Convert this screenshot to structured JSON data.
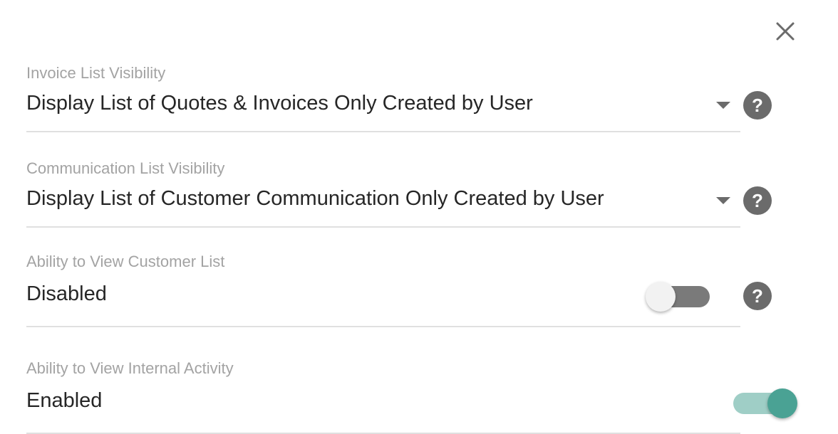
{
  "close": {
    "icon": "close-icon"
  },
  "fields": [
    {
      "label": "Invoice List Visibility",
      "value": "Display List of Quotes & Invoices Only Created by User",
      "control": "dropdown",
      "help_icon": "help-circle-icon"
    },
    {
      "label": "Communication List Visibility",
      "value": "Display List of Customer Communication Only Created by User",
      "control": "dropdown",
      "help_icon": "help-circle-icon"
    },
    {
      "label": "Ability to View Customer List",
      "value": "Disabled",
      "control": "toggle",
      "toggle_on": false,
      "help_icon": "help-circle-icon"
    },
    {
      "label": "Ability to View Internal Activity",
      "value": "Enabled",
      "control": "toggle",
      "toggle_on": true
    }
  ],
  "colors": {
    "label": "#a3a3a3",
    "value": "#262626",
    "toggle_on_knob": "#4aa294",
    "toggle_on_track": "#9fcec6",
    "toggle_off_track": "#7a7a7a",
    "icon": "#6b6b6b"
  }
}
